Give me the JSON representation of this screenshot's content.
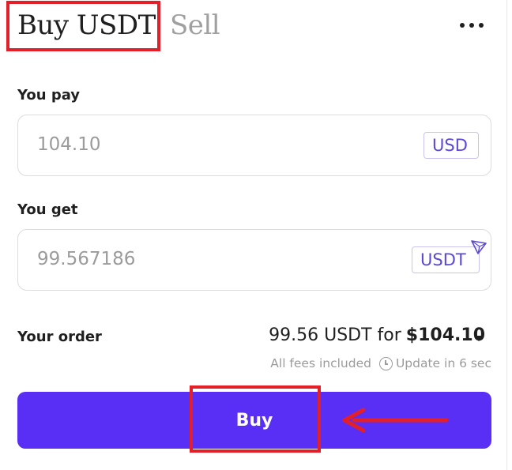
{
  "header": {
    "tab_buy": "Buy USDT",
    "tab_sell": "Sell"
  },
  "pay": {
    "label": "You pay",
    "value": "104.10",
    "currency": "USD"
  },
  "get": {
    "label": "You get",
    "value": "99.567186",
    "currency": "USDT",
    "network_icon": "tron-icon"
  },
  "order": {
    "label": "Your order",
    "amount": "99.56 USDT for",
    "price": "$104.10",
    "fees": "All fees included",
    "update": "Update in 6 sec"
  },
  "buy_button": {
    "label": "Buy"
  },
  "colors": {
    "accent": "#5a2ff5",
    "chip_text": "#5b49d6",
    "highlight": "#e3202a",
    "muted": "#9b9b9b"
  }
}
